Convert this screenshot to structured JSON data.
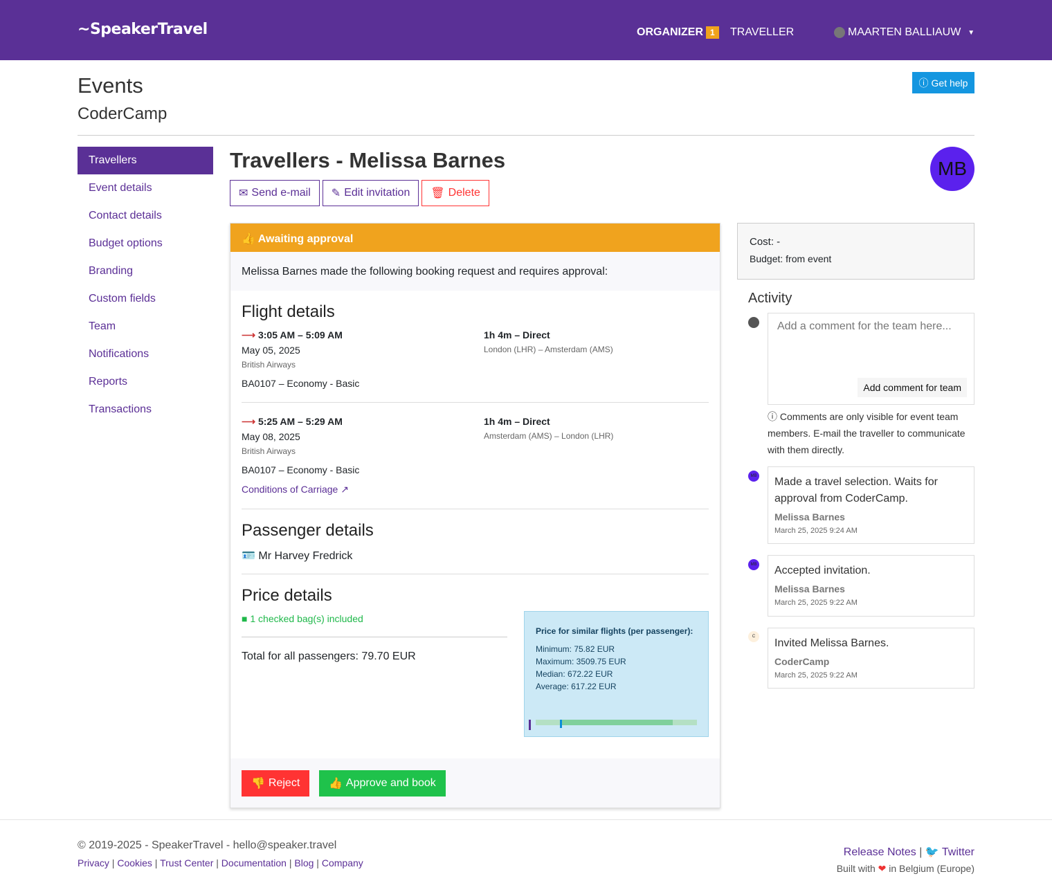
{
  "nav": {
    "logo": "SpeakerTravel",
    "organizer": "ORGANIZER",
    "organizer_badge": "1",
    "traveller": "TRAVELLER",
    "user": "MAARTEN BALLIAUW"
  },
  "page": {
    "title": "Events",
    "subtitle": "CoderCamp",
    "get_help": "Get help"
  },
  "sidebar": {
    "items": [
      {
        "label": "Travellers",
        "active": true
      },
      {
        "label": "Event details"
      },
      {
        "label": "Contact details"
      },
      {
        "label": "Budget options"
      },
      {
        "label": "Branding"
      },
      {
        "label": "Custom fields"
      },
      {
        "label": "Team"
      },
      {
        "label": "Notifications"
      },
      {
        "label": "Reports"
      },
      {
        "label": "Transactions"
      }
    ]
  },
  "main": {
    "title": "Travellers - Melissa Barnes",
    "avatar": "MB",
    "send_email": "Send e-mail",
    "edit_invitation": "Edit invitation",
    "delete": "Delete"
  },
  "request": {
    "status": "Awaiting approval",
    "intro": "Melissa Barnes made the following booking request and requires approval:",
    "flight_heading": "Flight details",
    "flights": [
      {
        "time": "3:05 AM – 5:09 AM",
        "date": "May 05, 2025",
        "airline": "British Airways",
        "fare": "BA0107 – Economy - Basic",
        "duration": "1h 4m – Direct",
        "route": "London (LHR) – Amsterdam (AMS)"
      },
      {
        "time": "5:25 AM – 5:29 AM",
        "date": "May 08, 2025",
        "airline": "British Airways",
        "fare": "BA0107 – Economy - Basic",
        "duration": "1h 4m – Direct",
        "route": "Amsterdam (AMS) – London (LHR)"
      }
    ],
    "conditions": "Conditions of Carriage",
    "passenger_heading": "Passenger details",
    "passenger": "Mr Harvey Fredrick",
    "price_heading": "Price details",
    "bags": "1 checked bag(s) included",
    "total": "Total for all passengers: 79.70 EUR",
    "similar": {
      "title": "Price for similar flights (per passenger):",
      "min": "Minimum: 75.82 EUR",
      "max": "Maximum: 3509.75 EUR",
      "median": "Median: 672.22 EUR",
      "average": "Average: 617.22 EUR"
    },
    "reject": "Reject",
    "approve": "Approve and book"
  },
  "sidebar_right": {
    "cost": "Cost: -",
    "budget": "Budget: from event",
    "activity_heading": "Activity",
    "comment_placeholder": "Add a comment for the team here...",
    "add_comment": "Add comment for team",
    "note": "Comments are only visible for event team members. E-mail the traveller to communicate with them directly.",
    "activity": [
      {
        "avatar": "MB",
        "text": "Made a travel selection. Waits for approval from CoderCamp.",
        "name": "Melissa Barnes",
        "date": "March 25, 2025 9:24 AM"
      },
      {
        "avatar": "MB",
        "text": "Accepted invitation.",
        "name": "Melissa Barnes",
        "date": "March 25, 2025 9:22 AM"
      },
      {
        "avatar": "C",
        "text": "Invited Melissa Barnes.",
        "name": "CoderCamp",
        "date": "March 25, 2025 9:22 AM"
      }
    ]
  },
  "footer": {
    "copyright": "© 2019-2025 - SpeakerTravel - hello@speaker.travel",
    "links": [
      "Privacy",
      "Cookies",
      "Trust Center",
      "Documentation",
      "Blog",
      "Company"
    ],
    "release_notes": "Release Notes",
    "twitter": "Twitter",
    "built_pre": "Built with",
    "built_post": "in Belgium (Europe)"
  },
  "colors": {
    "brand": "#5a3096",
    "warning": "#f0a31e",
    "danger": "#ff3333",
    "success": "#1fc24b",
    "info": "#1496e0"
  }
}
